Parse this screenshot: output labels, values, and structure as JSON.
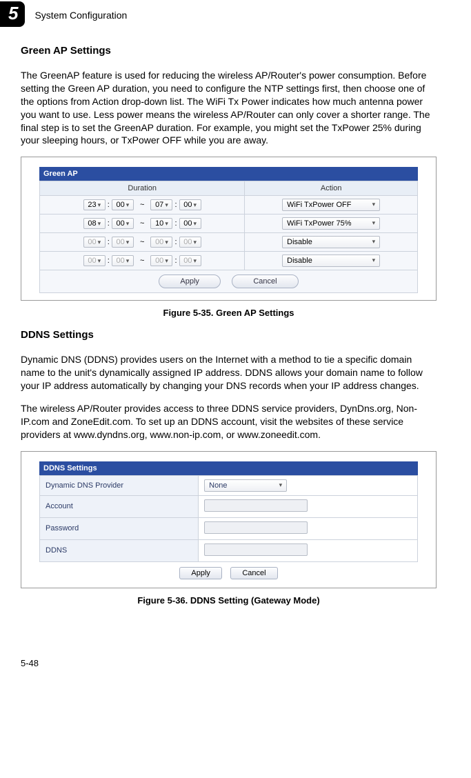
{
  "chapter": {
    "number": "5",
    "title": "System Configuration"
  },
  "section1": {
    "heading": "Green AP Settings",
    "paragraph": "The GreenAP feature is used for reducing the wireless AP/Router's power consumption. Before setting the Green AP duration, you need to configure the NTP settings first, then choose one of the options from Action drop-down list. The WiFi Tx Power indicates how much antenna power you want to use. Less power means the wireless AP/Router can only cover a shorter range. The final step is to set the GreenAP duration. For example, you might set the TxPower 25% during your sleeping hours, or TxPower OFF while you are away."
  },
  "greenap": {
    "panel_title": "Green AP",
    "col_duration": "Duration",
    "col_action": "Action",
    "rows": [
      {
        "h1": "23",
        "m1": "00",
        "h2": "07",
        "m2": "00",
        "action": "WiFi TxPower OFF",
        "enabled": true
      },
      {
        "h1": "08",
        "m1": "00",
        "h2": "10",
        "m2": "00",
        "action": "WiFi TxPower 75%",
        "enabled": true
      },
      {
        "h1": "00",
        "m1": "00",
        "h2": "00",
        "m2": "00",
        "action": "Disable",
        "enabled": false
      },
      {
        "h1": "00",
        "m1": "00",
        "h2": "00",
        "m2": "00",
        "action": "Disable",
        "enabled": false
      }
    ],
    "apply": "Apply",
    "cancel": "Cancel",
    "caption": "Figure 5-35.   Green AP Settings"
  },
  "section2": {
    "heading": "DDNS Settings",
    "p1": "Dynamic DNS (DDNS) provides users on the Internet with a method to tie a specific domain name to the unit's dynamically assigned IP address. DDNS allows your domain name to follow your IP address automatically by changing your DNS records when your IP address changes.",
    "p2": "The wireless AP/Router provides access to three DDNS service providers, DynDns.org, Non-IP.com and ZoneEdit.com. To set up an DDNS account, visit the websites of these service providers at www.dyndns.org, www.non-ip.com, or www.zoneedit.com."
  },
  "ddns": {
    "panel_title": "DDNS Settings",
    "row_provider": "Dynamic DNS Provider",
    "provider_value": "None",
    "row_account": "Account",
    "row_password": "Password",
    "row_ddns": "DDNS",
    "apply": "Apply",
    "cancel": "Cancel",
    "caption": "Figure 5-36.   DDNS Setting (Gateway Mode)"
  },
  "page_number": "5-48"
}
